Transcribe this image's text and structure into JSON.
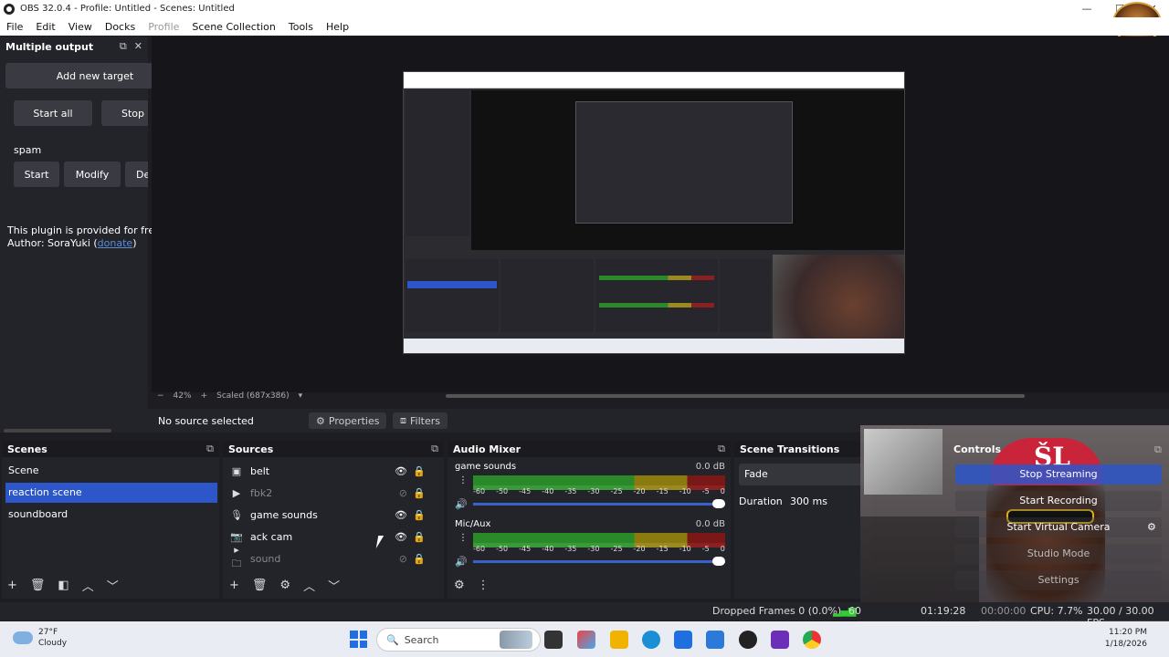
{
  "window": {
    "title": "OBS 32.0.4 - Profile: Untitled - Scenes: Untitled",
    "minimize": "—",
    "maximize": "☐",
    "close": "✕"
  },
  "menu": [
    "File",
    "Edit",
    "View",
    "Docks",
    "Profile",
    "Scene Collection",
    "Tools",
    "Help"
  ],
  "multiple_output": {
    "title": "Multiple output",
    "add_target": "Add new target",
    "start_all": "Start all",
    "stop_all": "Stop a",
    "target_name": "spam",
    "start": "Start",
    "modify": "Modify",
    "delete": "De",
    "info_line1": "This plugin is provided for free.",
    "info_line2_prefix": "Author: SoraYuki (",
    "donate": "donate",
    "info_line2_suffix": ")"
  },
  "zoom": {
    "minus": "−",
    "level": "42%",
    "plus": "+",
    "scaled": "Scaled (687x386)",
    "dropdown": "▾"
  },
  "source_bar": {
    "no_source": "No source selected",
    "properties": "Properties",
    "filters": "Filters"
  },
  "scenes": {
    "title": "Scenes",
    "items": [
      "Scene",
      "reaction scene",
      "soundboard"
    ],
    "active_index": 1
  },
  "sources": {
    "title": "Sources",
    "items": [
      {
        "name": "belt",
        "icon": "image-icon",
        "glyph": "▣"
      },
      {
        "name": "fbk2",
        "icon": "play-icon",
        "glyph": "▶"
      },
      {
        "name": "game sounds",
        "icon": "microphone-icon",
        "glyph": "🎙"
      },
      {
        "name": "ack cam",
        "icon": "camera-icon",
        "glyph": "📷"
      },
      {
        "name": "sound",
        "icon": "folder-icon",
        "glyph": "▸ 🗀"
      }
    ]
  },
  "mixer": {
    "title": "Audio Mixer",
    "tracks": [
      {
        "name": "game sounds",
        "db": "0.0 dB"
      },
      {
        "name": "Mic/Aux",
        "db": "0.0 dB"
      }
    ],
    "ticks": [
      "-60",
      "-50",
      "-45",
      "-40",
      "-35",
      "-30",
      "-25",
      "-20",
      "-15",
      "-10",
      "-5",
      "0"
    ]
  },
  "transitions": {
    "title": "Scene Transitions",
    "selected": "Fade",
    "duration_label": "Duration",
    "duration_value": "300 ms"
  },
  "controls": {
    "title": "Controls",
    "stop_streaming": "Stop Streaming",
    "start_recording": "Start Recording",
    "start_virtual_camera": "Start Virtual Camera",
    "studio_mode": "Studio Mode",
    "settings": "Settings"
  },
  "status": {
    "dropped": "Dropped Frames 0 (0.0%)",
    "stream_time": "01:19:28",
    "rec_time": "00:00:00",
    "cpu": "CPU: 7.7%",
    "fps": "30.00 / 30.00 FPS",
    "bitrate_prefix": "60"
  },
  "taskbar": {
    "temp": "27°F",
    "condition": "Cloudy",
    "search": "Search",
    "time": "11:20 PM",
    "date": "1/18/2026"
  },
  "colors": {
    "accent": "#2d56c9",
    "panel": "#23232a",
    "record_red": "#c9243a"
  }
}
